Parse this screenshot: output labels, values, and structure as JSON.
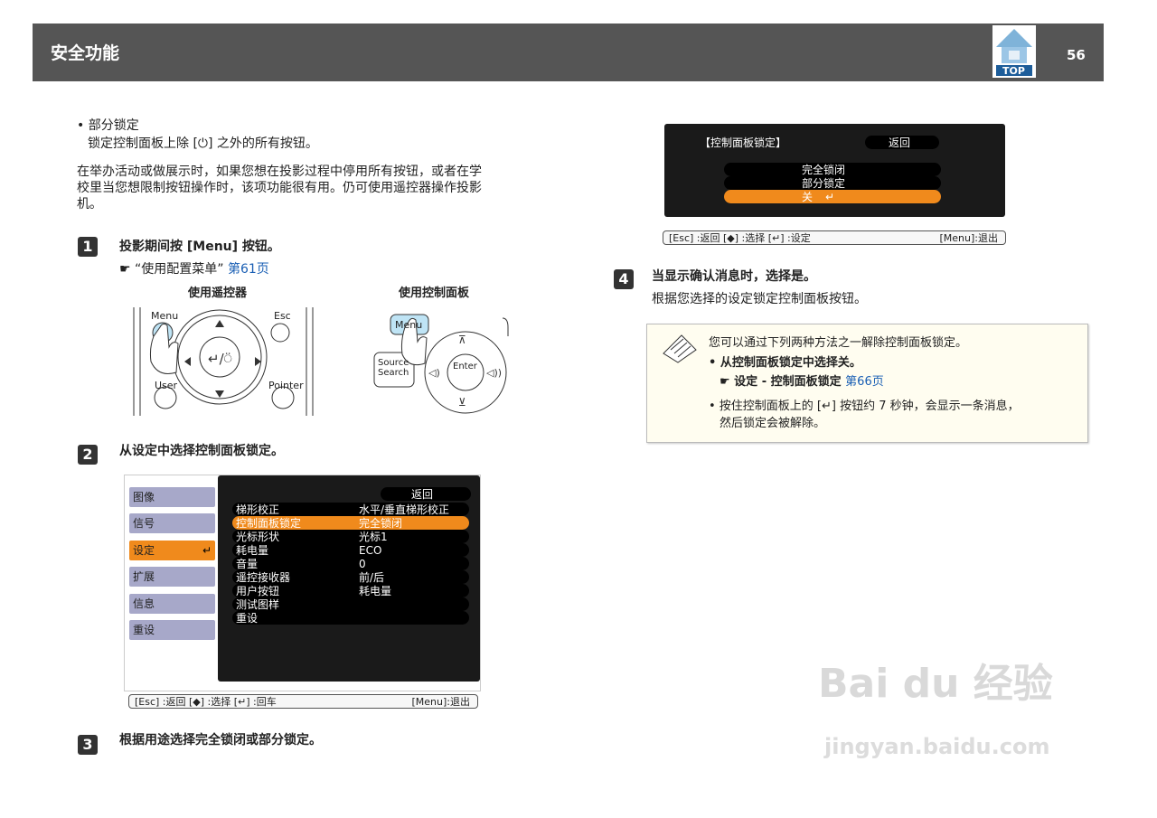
{
  "header": {
    "title": "安全功能",
    "page_number": "56",
    "top_badge": "TOP"
  },
  "left": {
    "bullet": "• 部分锁定",
    "bullet_desc": "锁定控制面板上除 [⏻] 之外的所有按钮。",
    "para_line1": "在举办活动或做展示时，如果您想在投影过程中停用所有按钮，或者在学",
    "para_line2": "校里当您想限制按钮操作时，该项功能很有用。仍可使用遥控器操作投影",
    "para_line3": "机。",
    "step1_num": "1",
    "step1_text": "投影期间按 [Menu] 按钮。",
    "step1_ref_prefix": "☛ “使用配置菜单”",
    "step1_ref_link": "第61页",
    "remote_caption": "使用遥控器",
    "panel_caption": "使用控制面板",
    "remote_labels": {
      "menu": "Menu",
      "esc": "Esc",
      "user": "User",
      "pointer": "Pointer"
    },
    "panel_labels": {
      "menu": "Menu",
      "source": "Source Search",
      "enter": "Enter"
    },
    "step2_num": "2",
    "step2_text": "从设定中选择控制面板锁定。",
    "step3_num": "3",
    "step3_text": "根据用途选择完全锁闭或部分锁定。"
  },
  "menu_screen": {
    "side": [
      "图像",
      "信号",
      "设定",
      "扩展",
      "信息",
      "重设"
    ],
    "back": "返回",
    "rows": [
      {
        "k": "梯形校正",
        "v": "水平/垂直梯形校正"
      },
      {
        "k": "控制面板锁定",
        "v": "完全锁闭"
      },
      {
        "k": "光标形状",
        "v": "光标1"
      },
      {
        "k": "耗电量",
        "v": "ECO"
      },
      {
        "k": "音量",
        "v": "0"
      },
      {
        "k": "遥控接收器",
        "v": "前/后"
      },
      {
        "k": "用户按钮",
        "v": "耗电量"
      },
      {
        "k": "测试图样",
        "v": ""
      },
      {
        "k": "重设",
        "v": ""
      }
    ],
    "status_left": "[Esc] :返回 [◆] :选择 [↵] :回车",
    "status_right": "[Menu]:退出"
  },
  "lock_screen": {
    "title": "【控制面板锁定】",
    "back": "返回",
    "options": [
      "完全锁闭",
      "部分锁定",
      "关"
    ],
    "status_left": "[Esc] :返回 [◆] :选择 [↵] :设定",
    "status_right": "[Menu]:退出"
  },
  "right": {
    "step4_num": "4",
    "step4_text": "当显示确认消息时，选择是。",
    "step4_desc": "根据您选择的设定锁定控制面板按钮。",
    "note_title": "您可以通过下列两种方法之一解除控制面板锁定。",
    "note_b1": "• 从控制面板锁定中选择关。",
    "note_b1_ref_prefix": "☛ 设定 - 控制面板锁定",
    "note_b1_ref_link": "第66页",
    "note_b2_line1": "• 按住控制面板上的 [↵] 按钮约 7 秒钟，会显示一条消息，",
    "note_b2_line2": "然后锁定会被解除。"
  },
  "watermark": {
    "brand": "Bai du 经验",
    "url": "jingyan.baidu.com"
  }
}
